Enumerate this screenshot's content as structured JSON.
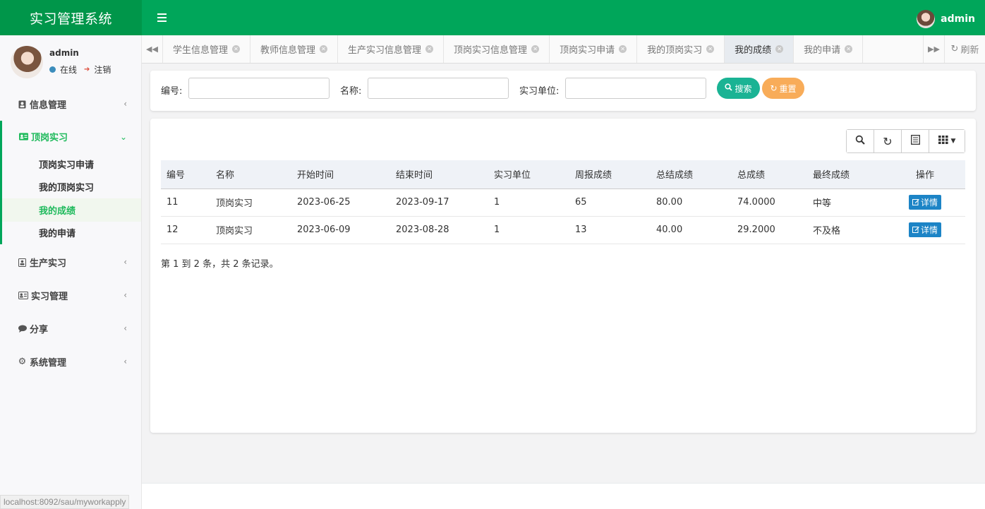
{
  "app": {
    "title": "实习管理系统"
  },
  "header": {
    "username": "admin"
  },
  "sidebar": {
    "user": {
      "name": "admin",
      "status": "在线",
      "logout": "注销"
    },
    "menu": [
      {
        "label": "信息管理"
      },
      {
        "label": "顶岗实习",
        "children": [
          "顶岗实习申请",
          "我的顶岗实习",
          "我的成绩",
          "我的申请"
        ]
      },
      {
        "label": "生产实习"
      },
      {
        "label": "实习管理"
      },
      {
        "label": "分享"
      },
      {
        "label": "系统管理"
      }
    ],
    "status_url": "localhost:8092/sau/myworkapply"
  },
  "tabs": [
    "学生信息管理",
    "教师信息管理",
    "生产实习信息管理",
    "顶岗实习信息管理",
    "顶岗实习申请",
    "我的顶岗实习",
    "我的成绩",
    "我的申请"
  ],
  "tabs_active": "我的成绩",
  "refresh_label": "刷新",
  "search": {
    "fields": [
      {
        "label": "编号:",
        "value": ""
      },
      {
        "label": "名称:",
        "value": ""
      },
      {
        "label": "实习单位:",
        "value": ""
      }
    ],
    "search_label": "搜索",
    "reset_label": "重置"
  },
  "table": {
    "columns": [
      "编号",
      "名称",
      "开始时间",
      "结束时间",
      "实习单位",
      "周报成绩",
      "总结成绩",
      "总成绩",
      "最终成绩",
      "操作"
    ],
    "rows": [
      [
        "11",
        "顶岗实习",
        "2023-06-25",
        "2023-09-17",
        "1",
        "65",
        "80.00",
        "74.0000",
        "中等"
      ],
      [
        "12",
        "顶岗实习",
        "2023-06-09",
        "2023-08-28",
        "1",
        "13",
        "40.00",
        "29.2000",
        "不及格"
      ]
    ],
    "detail_label": "详情",
    "pager_text": "第 1 到 2 条，共 2 条记录。"
  },
  "colors": {
    "brand": "#00a65a",
    "brand_dark": "#00964a",
    "search_btn": "#1ab394",
    "reset_btn": "#f8ac59",
    "detail_btn": "#1c84c6"
  }
}
